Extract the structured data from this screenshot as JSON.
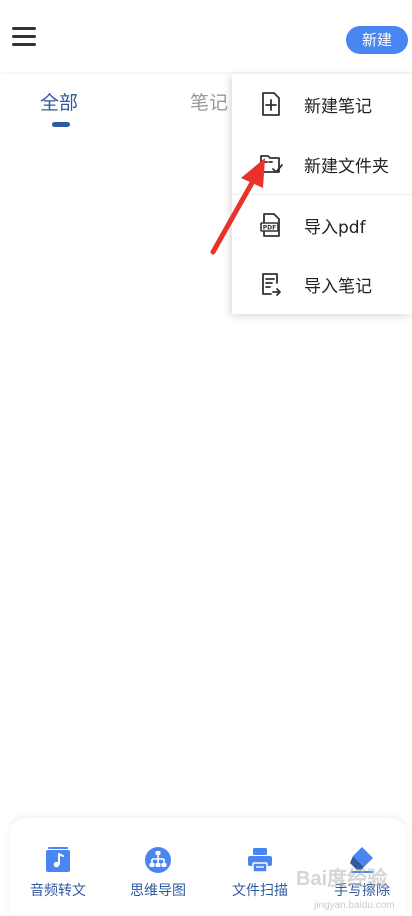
{
  "header": {
    "menu_icon": "hamburger-menu-icon",
    "new_button_label": "新建"
  },
  "tabs": [
    {
      "label": "全部",
      "active": true
    },
    {
      "label": "笔记",
      "active": false
    }
  ],
  "dropdown": {
    "items": [
      {
        "label": "新建笔记",
        "icon": "new-note-icon"
      },
      {
        "label": "新建文件夹",
        "icon": "new-folder-icon"
      },
      {
        "label": "导入pdf",
        "icon": "pdf-icon"
      },
      {
        "label": "导入笔记",
        "icon": "import-note-icon"
      }
    ]
  },
  "toolbar": {
    "items": [
      {
        "label": "音频转文",
        "icon": "audio-transcribe-icon"
      },
      {
        "label": "思维导图",
        "icon": "mind-map-icon"
      },
      {
        "label": "文件扫描",
        "icon": "scanner-icon"
      },
      {
        "label": "手写擦除",
        "icon": "eraser-icon"
      }
    ]
  },
  "watermark": {
    "text": "Bai度经验",
    "sub": "jingyan.baidu.com"
  },
  "colors": {
    "accent": "#4a86f2",
    "primary_text": "#2f5aa0",
    "annotation": "#e8322a"
  }
}
